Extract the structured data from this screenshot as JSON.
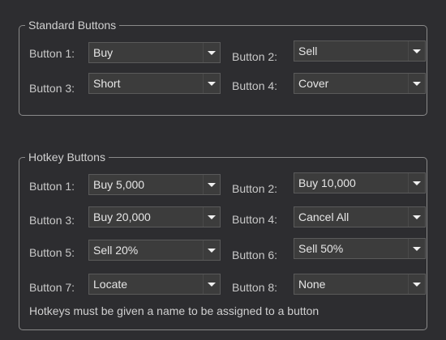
{
  "standard": {
    "title": "Standard Buttons",
    "buttons": [
      {
        "label": "Button 1:",
        "value": "Buy"
      },
      {
        "label": "Button 2:",
        "value": "Sell"
      },
      {
        "label": "Button 3:",
        "value": "Short"
      },
      {
        "label": "Button 4:",
        "value": "Cover"
      }
    ]
  },
  "hotkey": {
    "title": "Hotkey Buttons",
    "buttons": [
      {
        "label": "Button 1:",
        "value": "Buy 5,000"
      },
      {
        "label": "Button 2:",
        "value": "Buy 10,000"
      },
      {
        "label": "Button 3:",
        "value": "Buy 20,000"
      },
      {
        "label": "Button 4:",
        "value": "Cancel All"
      },
      {
        "label": "Button 5:",
        "value": "Sell 20%"
      },
      {
        "label": "Button 6:",
        "value": "Sell 50%"
      },
      {
        "label": "Button 7:",
        "value": "Locate"
      },
      {
        "label": "Button 8:",
        "value": "None"
      }
    ],
    "note": "Hotkeys must be given a name to be assigned to a button"
  },
  "icons": {
    "dropdown": "chevron-down-icon"
  },
  "colors": {
    "background": "#2d2d30",
    "combo_background": "#3c3c3c",
    "text": "#c8c8c8"
  }
}
